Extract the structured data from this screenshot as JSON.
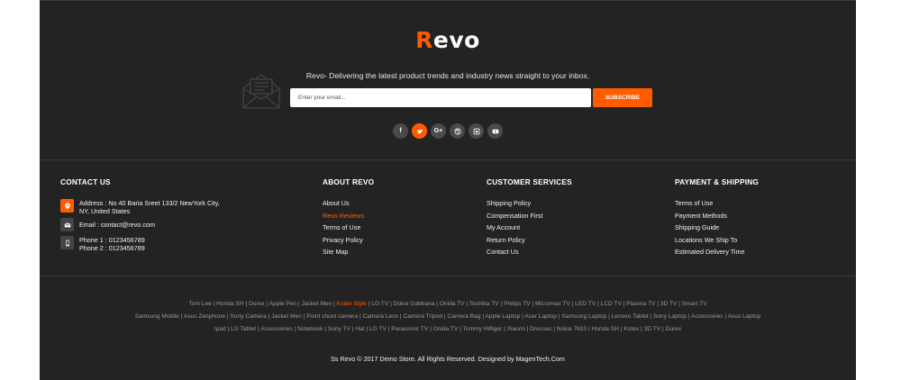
{
  "brand": {
    "logo_first": "R",
    "logo_rest": "evo",
    "accent_color": "#ff5c00",
    "bg_color": "#232323"
  },
  "newsletter": {
    "text": "Revo- Delivering the latest product trends and industry news straight to your inbox.",
    "placeholder": "Enter your email...",
    "button": "SUBSCRIBE"
  },
  "social": [
    {
      "icon": "facebook-icon",
      "glyph": "f"
    },
    {
      "icon": "twitter-icon",
      "glyph": "t"
    },
    {
      "icon": "google-plus-icon",
      "glyph": "G+"
    },
    {
      "icon": "dribbble-icon",
      "glyph": ""
    },
    {
      "icon": "instagram-icon",
      "glyph": ""
    },
    {
      "icon": "youtube-icon",
      "glyph": ""
    }
  ],
  "contact": {
    "title": "CONTACT US",
    "address_line1": "Address : No 40 Baria Sreet 133/2 NewYork City,",
    "address_line2": "NY, United States",
    "email": "Email : contact@revo.com",
    "phone1": "Phone 1 : 0123456789",
    "phone2": "Phone 2 : 0123456789"
  },
  "about": {
    "title": "ABOUT REVO",
    "links": [
      "About Us",
      "Revo Reviews",
      "Terms of Use",
      "Privacy Policy",
      "Site Map"
    ]
  },
  "customer": {
    "title": "CUSTOMER SERVICES",
    "links": [
      "Shipping Policy",
      "Compensation First",
      "My Account",
      "Return Policy",
      "Contact Us"
    ]
  },
  "payment": {
    "title": "PAYMENT & SHIPPING",
    "links": [
      "Terms of Use",
      "Payment Methods",
      "Shipping Guide",
      "Locations We Ship To",
      "Estimated Delivery Time"
    ]
  },
  "tags": {
    "line1": [
      "Tom Lee",
      "Honda SH",
      "Durex",
      "Apple Pen",
      "Jacket Men",
      "Kotex Style",
      "LG TV",
      "Dolce Gabbana",
      "Onida TV",
      "Toshiba TV",
      "Philips TV",
      "Micromax TV",
      "LED TV",
      "LCD TV",
      "Plasma TV",
      "3D TV",
      "Smart TV"
    ],
    "line2": [
      "Samsung Mobile",
      "Asus Zenphone",
      "Sony Camera",
      "Jacket Men",
      "Point shoot camera",
      "Camera Lens",
      "Camera Tripod",
      "Camera Bag",
      "Apple Laptop",
      "Acer Laptop",
      "Samsung Laptop",
      "Lenovo Tablet",
      "Sony Laptop",
      "Accessories",
      "Asus Laptop"
    ],
    "line3": [
      "Ipad",
      "LG Tablet",
      "Accessories",
      "Notebook",
      "Sony TV",
      "Hat",
      "LG TV",
      "Panasonic TV",
      "Onida TV",
      "Tommy Hilfiger",
      "Xiaomi",
      "Dresses",
      "Nokia 7610",
      "Honda SH",
      "Kotex",
      "3D TV",
      "Durex"
    ],
    "highlight": "Kotex Style"
  },
  "copyright": "Ss Revo © 2017 Demo Store. All Rights Reserved. Designed by MagenTech.Com"
}
